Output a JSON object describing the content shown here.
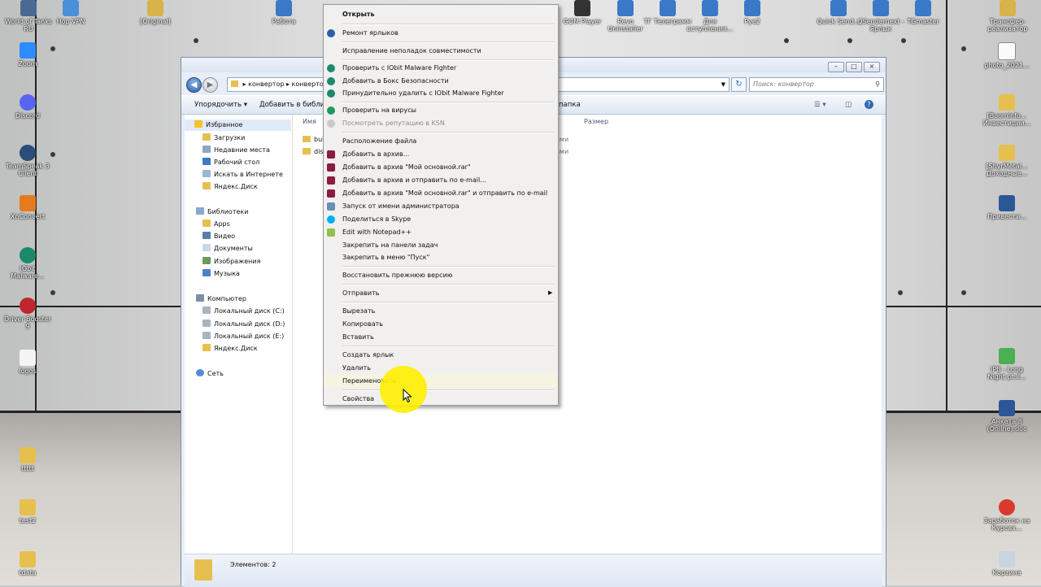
{
  "desktop": {
    "top_icons": [
      "World of Tanks RU",
      "Hop VPN",
      "[Original]",
      "Работа",
      "GOM Player",
      "Revo Uninstaller",
      "ТГ Телеграмм",
      "Для вступления...",
      "Руе2",
      "Quick Send...",
      "QSendernext - Ярлык",
      "TGmaster",
      "Трансфер-реализатор"
    ],
    "left_icons": [
      "Zoom",
      "Discord",
      "TeamSpeak 3 Client",
      "XnConvert",
      "IObit Malware...",
      "Driver Booster 9",
      "logos",
      "ttttt",
      "test2",
      "tdata"
    ],
    "right_icons": [
      "photo_2021...",
      "[Boomlnfo... Инвестиции...",
      "[ShyrMetal... Доходные...",
      "Привести...",
      "IPB - Long Night pt.II...",
      "Анкета 8 (Online).doc",
      "Заработок на Курсах...",
      "Корзина"
    ]
  },
  "window": {
    "address_segments": [
      "конвертор",
      "конвертор"
    ],
    "search_placeholder": "Поиск: конвертор",
    "toolbar": {
      "organize": "Упорядочить ▾",
      "add_to_library": "Добавить в библиот",
      "new_folder_fragment": "папка"
    },
    "nav": {
      "favorites_header": "Избранное",
      "favorites": [
        "Загрузки",
        "Недавние места",
        "Рабочий стол",
        "Искать в Интернете",
        "Яндекс.Диск"
      ],
      "libraries_header": "Библиотеки",
      "libraries": [
        "Apps",
        "Видео",
        "Документы",
        "Изображения",
        "Музыка"
      ],
      "computer_header": "Компьютер",
      "computer": [
        "Локальный диск (C:)",
        "Локальный диск (D:)",
        "Локальный диск (E:)",
        "Яндекс.Диск"
      ],
      "network": "Сеть"
    },
    "columns": {
      "name": "Имя",
      "size": "Размер"
    },
    "files": [
      "bui",
      "dis"
    ],
    "file_type_fragments": [
      "ами",
      "ами"
    ],
    "status": "Элементов: 2"
  },
  "context_menu": {
    "items": [
      {
        "label": "Открыть",
        "bold": true
      },
      {
        "label": "Ремонт ярлыков",
        "icon": "repair-icon"
      },
      {
        "label": "Исправление неполадок совместимости"
      },
      {
        "label": "Проверить с IObit Malware Fighter",
        "icon": "iobit-icon"
      },
      {
        "label": "Добавить в Бокс Безопасности",
        "icon": "iobit-icon"
      },
      {
        "label": "Принудительно удалить с IObit Malware Fighter",
        "icon": "iobit-icon"
      },
      {
        "label": "Проверить на вирусы",
        "icon": "kaspersky-icon"
      },
      {
        "label": "Посмотреть репутацию в KSN",
        "icon": "kaspersky-icon",
        "disabled": true
      },
      {
        "label": "Расположение файла"
      },
      {
        "label": "Добавить в архив...",
        "icon": "winrar-icon"
      },
      {
        "label": "Добавить в архив \"Мой основной.rar\"",
        "icon": "winrar-icon"
      },
      {
        "label": "Добавить в архив и отправить по e-mail...",
        "icon": "winrar-icon"
      },
      {
        "label": "Добавить в архив \"Мой основной.rar\" и отправить по e-mail",
        "icon": "winrar-icon"
      },
      {
        "label": "Запуск от имени администратора",
        "icon": "shield-icon"
      },
      {
        "label": "Поделиться в Skype",
        "icon": "skype-icon"
      },
      {
        "label": "Edit with Notepad++",
        "icon": "notepadpp-icon"
      },
      {
        "label": "Закрепить на панели задач"
      },
      {
        "label": "Закрепить в меню \"Пуск\""
      },
      {
        "label": "Восстановить прежнюю версию"
      },
      {
        "label": "Отправить",
        "submenu": true
      },
      {
        "label": "Вырезать"
      },
      {
        "label": "Копировать"
      },
      {
        "label": "Вставить"
      },
      {
        "label": "Создать ярлык"
      },
      {
        "label": "Удалить"
      },
      {
        "label": "Переименовать"
      },
      {
        "label": "Свойства"
      }
    ]
  }
}
